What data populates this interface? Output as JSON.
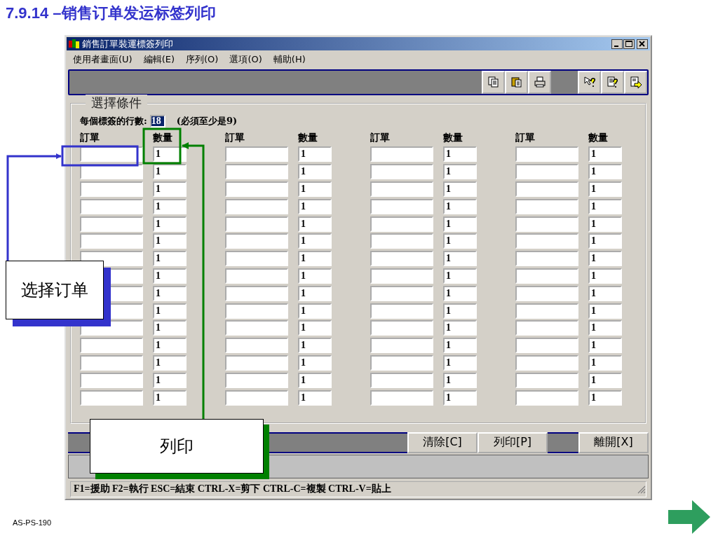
{
  "slide": {
    "title": "7.9.14 –销售订单发运标签列印",
    "footer": "AS-PS-190"
  },
  "window": {
    "title": "銷售訂單裝運標簽列印"
  },
  "menu": [
    "使用者畫面(U)",
    "編輯(E)",
    "序列(O)",
    "選項(O)",
    "輔助(H)"
  ],
  "group": {
    "legend": "選擇條件",
    "lines_label": "每個標簽的行數:",
    "lines_value": "18",
    "lines_hint": "(必須至少是9)"
  },
  "blocks": [
    {
      "order_header": "訂單",
      "qty_header": "數量",
      "quantities": [
        "1",
        "1",
        "1",
        "1",
        "1",
        "1",
        "1",
        "1",
        "1",
        "1",
        "1",
        "1",
        "1",
        "1",
        "1"
      ]
    },
    {
      "order_header": "訂單",
      "qty_header": "數量",
      "quantities": [
        "1",
        "1",
        "1",
        "1",
        "1",
        "1",
        "1",
        "1",
        "1",
        "1",
        "1",
        "1",
        "1",
        "1",
        "1"
      ]
    },
    {
      "order_header": "訂單",
      "qty_header": "數量",
      "quantities": [
        "1",
        "1",
        "1",
        "1",
        "1",
        "1",
        "1",
        "1",
        "1",
        "1",
        "1",
        "1",
        "1",
        "1",
        "1"
      ]
    },
    {
      "order_header": "訂單",
      "qty_header": "數量",
      "quantities": [
        "1",
        "1",
        "1",
        "1",
        "1",
        "1",
        "1",
        "1",
        "1",
        "1",
        "1",
        "1",
        "1",
        "1",
        "1"
      ]
    }
  ],
  "buttons": [
    "清除[C]",
    "列印[P]",
    "離開[X]"
  ],
  "status_bar": "F1=援助 F2=執行 ESC=結束 CTRL-X=剪下 CTRL-C=複製 CTRL-V=貼上",
  "callouts": [
    {
      "kind": "order",
      "text": "选择订单"
    },
    {
      "kind": "print",
      "text": "列印"
    }
  ]
}
